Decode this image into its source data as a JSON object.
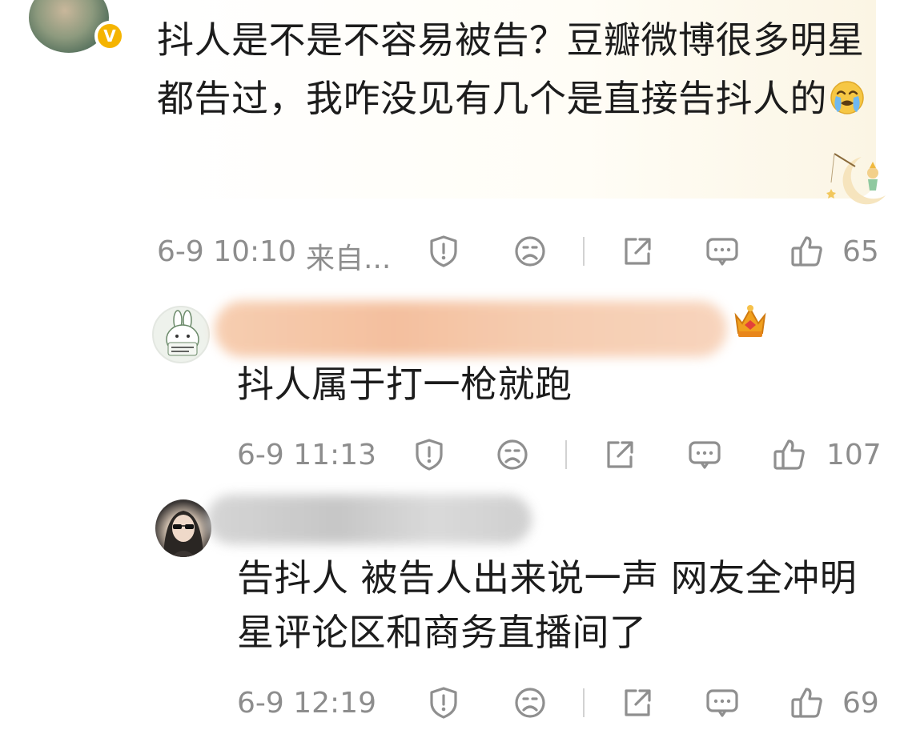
{
  "main_comment": {
    "text": "抖人是不是不容易被告？豆瓣微博很多明星都告过，我咋没见有几个是直接告抖人的",
    "verified_badge": "V",
    "emoji": "crying-emoji",
    "meta": {
      "time": "6-9 10:10",
      "source": "来自...",
      "like_count": "65"
    }
  },
  "replies": [
    {
      "text": "抖人属于打一枪就跑",
      "username_obscured": true,
      "badge": "crown-badge",
      "meta": {
        "time": "6-9 11:13",
        "like_count": "107"
      }
    },
    {
      "text": "告抖人  被告人出来说一声  网友全冲明星评论区和商务直播间了",
      "username_obscured": true,
      "meta": {
        "time": "6-9 12:19",
        "like_count": "69"
      }
    }
  ],
  "icons": {
    "report": "shield-alert-icon",
    "dislike": "sad-face-icon",
    "share": "share-icon",
    "comment": "comment-icon",
    "like": "thumbs-up-icon"
  },
  "colors": {
    "meta_text": "#8d8d8d",
    "verified": "#f5b400",
    "bubble_bg": "#fbf5e4"
  }
}
